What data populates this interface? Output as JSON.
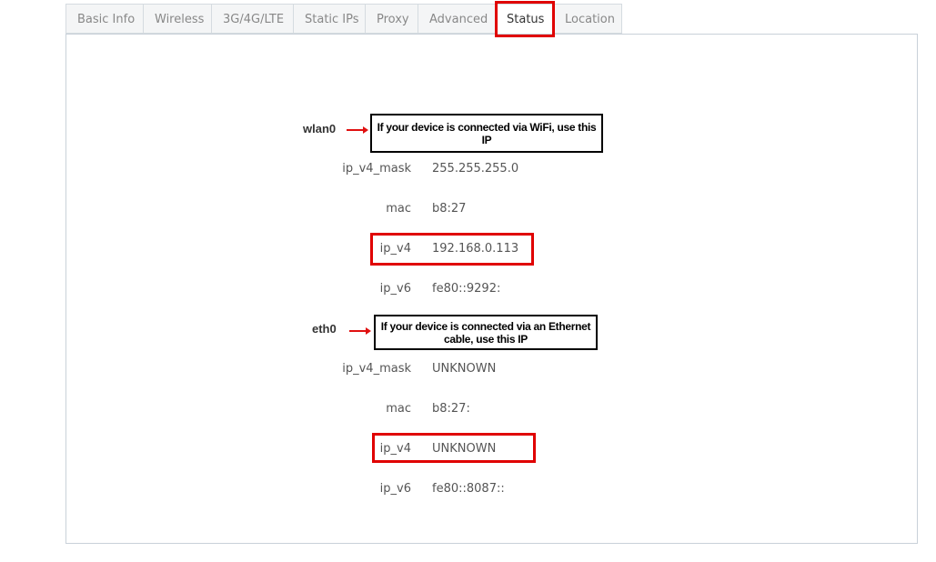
{
  "tabs": [
    {
      "label": "Basic Info",
      "active": false
    },
    {
      "label": "Wireless",
      "active": false
    },
    {
      "label": "3G/4G/LTE",
      "active": false
    },
    {
      "label": "Static IPs",
      "active": false
    },
    {
      "label": "Proxy",
      "active": false
    },
    {
      "label": "Advanced",
      "active": false
    },
    {
      "label": "Status",
      "active": true
    },
    {
      "label": "Location",
      "active": false
    }
  ],
  "interfaces": {
    "wlan0": {
      "name": "wlan0",
      "note": "If your device is connected via WiFi, use this IP",
      "fields": {
        "ip_v4_mask": {
          "label": "ip_v4_mask",
          "value": "255.255.255.0"
        },
        "mac": {
          "label": "mac",
          "value": "b8:27"
        },
        "ip_v4": {
          "label": "ip_v4",
          "value": "192.168.0.113"
        },
        "ip_v6": {
          "label": "ip_v6",
          "value": "fe80::9292:"
        }
      }
    },
    "eth0": {
      "name": "eth0",
      "note": "If your device is connected via an Ethernet cable, use this IP",
      "fields": {
        "ip_v4_mask": {
          "label": "ip_v4_mask",
          "value": "UNKNOWN"
        },
        "mac": {
          "label": "mac",
          "value": "b8:27:"
        },
        "ip_v4": {
          "label": "ip_v4",
          "value": "UNKNOWN"
        },
        "ip_v6": {
          "label": "ip_v6",
          "value": "fe80::8087::"
        }
      }
    }
  },
  "annotation_color": "#e00000"
}
